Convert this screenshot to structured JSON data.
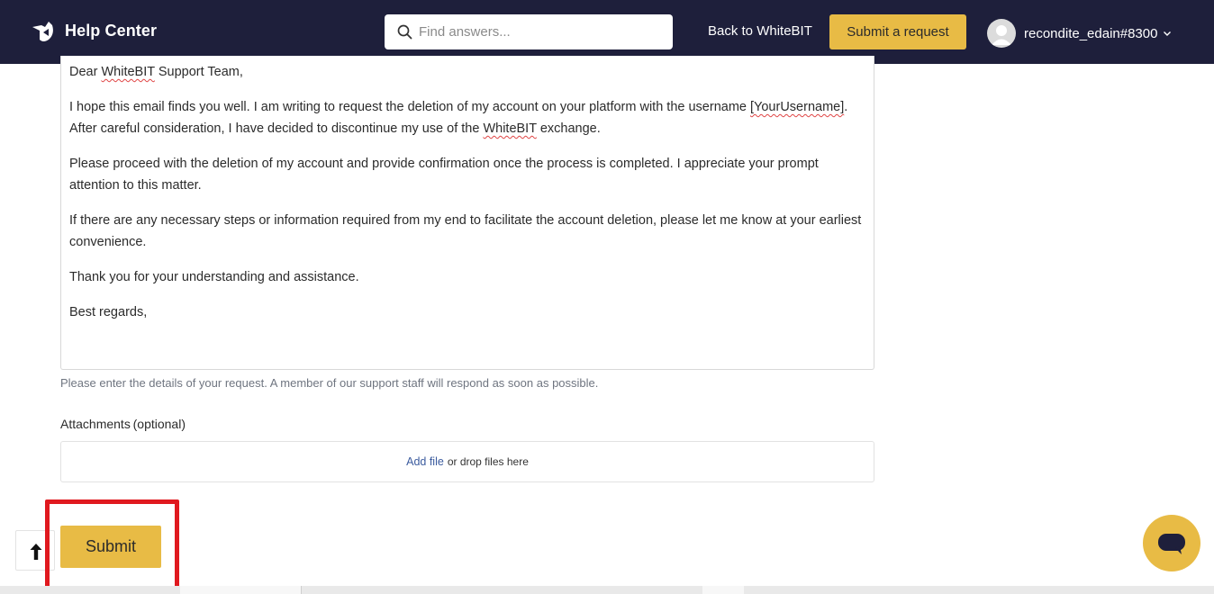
{
  "header": {
    "brand": "Help Center",
    "logo_icon": "whitebit-logo-icon",
    "search": {
      "placeholder": "Find answers...",
      "value": "",
      "icon": "search-icon"
    },
    "back_link": "Back to WhiteBIT",
    "submit_request_label": "Submit a request",
    "user": {
      "name": "recondite_edain#8300",
      "avatar_icon": "user-avatar-icon",
      "chevron_icon": "chevron-down-icon"
    },
    "colors": {
      "background": "#1e1f3b",
      "accent": "#e8bb45"
    }
  },
  "form": {
    "description": {
      "line_greeting": "Dear WhiteBIT Support Team,",
      "para1_a": "I hope this email finds you well. I am writing to request the deletion of my account on your platform with the username ",
      "para1_user": "[YourUsername]",
      "para1_b": ". After careful consideration, I have decided to discontinue my use of the ",
      "para1_brand": "WhiteBIT",
      "para1_c": " exchange.",
      "para2": "Please proceed with the deletion of my account and provide confirmation once the process is completed. I appreciate your prompt attention to this matter.",
      "para3": "If there are any necessary steps or information required from my end to facilitate the account deletion, please let me know at your earliest convenience.",
      "para4": "Thank you for your understanding and assistance.",
      "para5": "Best regards,",
      "greeting_prefix": "Dear ",
      "greeting_brand": "WhiteBIT",
      "greeting_suffix": " Support Team,"
    },
    "hint": "Please enter the details of your request. A member of our support staff will respond as soon as possible.",
    "attachments_label": "Attachments (optional)",
    "dropzone": {
      "add_file": "Add file",
      "rest": "or drop files here"
    },
    "submit_label": "Submit"
  },
  "widgets": {
    "scroll_top_icon": "arrow-up-icon",
    "chat_icon": "chat-bubble-icon",
    "highlight_color": "#e0191f"
  }
}
